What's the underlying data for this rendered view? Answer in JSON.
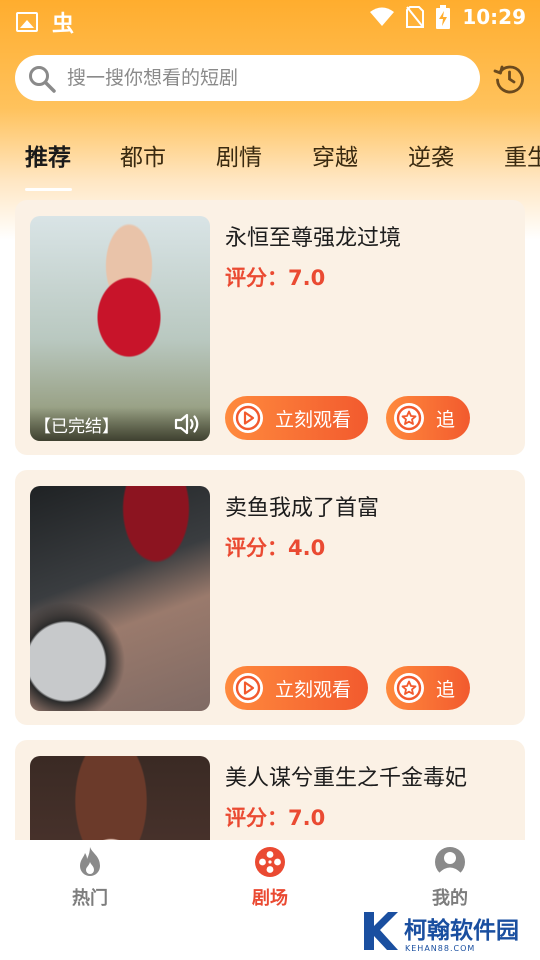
{
  "status_bar": {
    "app_glyph": "虫",
    "time": "10:29"
  },
  "search": {
    "placeholder": "搜一搜你想看的短剧"
  },
  "tabs": [
    {
      "label": "推荐",
      "active": true
    },
    {
      "label": "都市"
    },
    {
      "label": "剧情"
    },
    {
      "label": "穿越"
    },
    {
      "label": "逆袭"
    },
    {
      "label": "重生"
    }
  ],
  "dramas": [
    {
      "title": "永恒至尊强龙过境",
      "score": "评分：7.0",
      "status": "【已完结】"
    },
    {
      "title": "卖鱼我成了首富",
      "score": "评分：4.0"
    },
    {
      "title": "美人谋兮重生之千金毒妃",
      "score": "评分：7.0"
    }
  ],
  "actions": {
    "watch_label": "立刻观看",
    "follow_label": "追"
  },
  "bottom_nav": [
    {
      "label": "热门",
      "icon": "fire-icon"
    },
    {
      "label": "剧场",
      "icon": "film-reel-icon",
      "active": true
    },
    {
      "label": "我的",
      "icon": "user-icon"
    }
  ],
  "watermark": {
    "brand": "柯翰软件园",
    "url": "KEHAN88.COM"
  },
  "colors": {
    "accent": "#ea4a32",
    "top_gradient": "#ffad2e",
    "card_bg": "#fbf1e5"
  }
}
